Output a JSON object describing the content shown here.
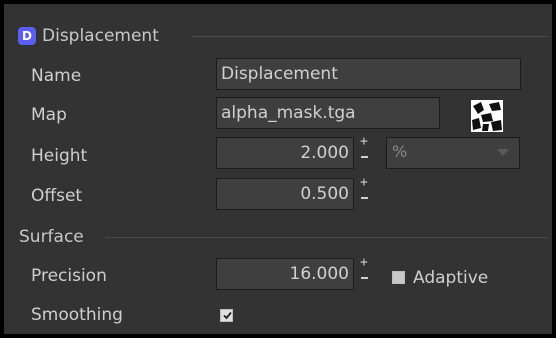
{
  "displacement_section": {
    "badge": "D",
    "title": "Displacement"
  },
  "name": {
    "label": "Name",
    "value": "Displacement"
  },
  "map": {
    "label": "Map",
    "value": "alpha_mask.tga",
    "thumbnail_icon": "checker-texture-icon"
  },
  "height": {
    "label": "Height",
    "value": "2.000",
    "unit": "%"
  },
  "offset": {
    "label": "Offset",
    "value": "0.500"
  },
  "surface_section": {
    "title": "Surface"
  },
  "precision": {
    "label": "Precision",
    "value": "16.000"
  },
  "adaptive": {
    "label": "Adaptive",
    "checked": false
  },
  "smoothing": {
    "label": "Smoothing",
    "checked": true
  },
  "colors": {
    "panel_bg": "#333333",
    "field_bg": "#3f3f3f",
    "badge_accent": "#5b5ef0"
  }
}
